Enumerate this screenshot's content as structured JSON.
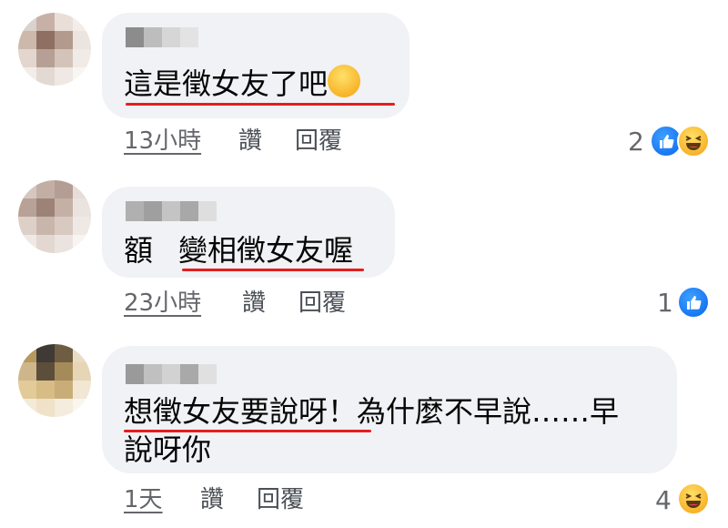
{
  "comments": [
    {
      "text": "這是徵女友了吧",
      "time": "13小時",
      "like_label": "讚",
      "reply_label": "回覆",
      "reaction_count": "2",
      "reactions": [
        "like-icon",
        "haha-icon"
      ]
    },
    {
      "text_prefix": "額",
      "text": "變相徵女友喔",
      "time": "23小時",
      "like_label": "讚",
      "reply_label": "回覆",
      "reaction_count": "1",
      "reactions": [
        "like-icon"
      ]
    },
    {
      "text_line1_underlined": "想徵女友要說呀",
      "text_line1_rest": "！為什麼不早說……早",
      "text_line2": "說呀你",
      "time": "1天",
      "like_label": "讚",
      "reply_label": "回覆",
      "reaction_count": "4",
      "reactions": [
        "haha-icon"
      ]
    }
  ],
  "colors": {
    "bubble": "#f0f2f5",
    "underline": "#e41e1e",
    "meta_text": "#65676b",
    "like_blue": "#1877f2",
    "haha_yellow": "#f7b125"
  }
}
